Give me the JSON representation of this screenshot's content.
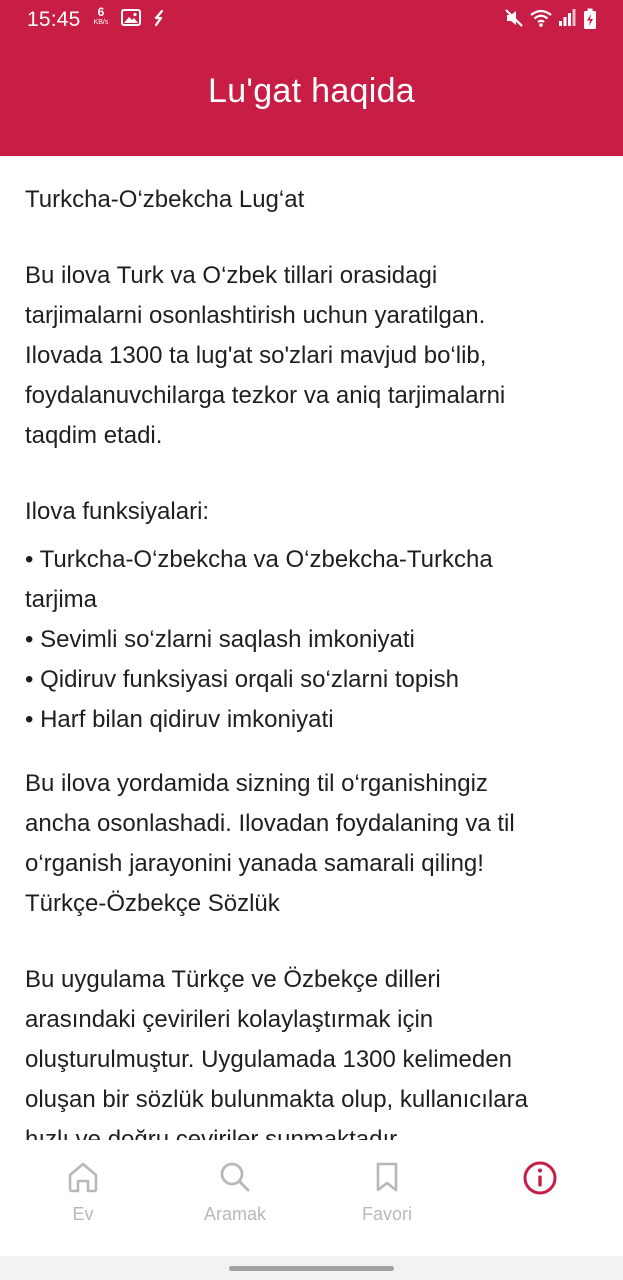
{
  "status_bar": {
    "time": "15:45",
    "net_speed_value": "6",
    "net_speed_unit": "KB/s",
    "icons": [
      "image-icon",
      "sync-icon",
      "mute-icon",
      "wifi-icon",
      "signal-icon",
      "battery-charging-icon"
    ]
  },
  "header": {
    "title": "Lu'gat haqida",
    "background_color": "#c81e45"
  },
  "content": {
    "heading_uz": "Turkcha-O‘zbekcha Lug‘at",
    "intro_uz": "Bu ilova Turk va O‘zbek tillari orasidagi\ntarjimalarni osonlashtirish uchun yaratilgan.\nIlovada 1300 ta lug'at so'zlari mavjud bo‘lib,\nfoydalanuvchilarga tezkor va aniq tarjimalarni\ntaqdim etadi.",
    "features_title": "Ilova funksiyalari:",
    "features": [
      "• Turkcha-O‘zbekcha va O‘zbekcha-Turkcha\ntarjima",
      "• Sevimli so‘zlarni saqlash imkoniyati",
      "• Qidiruv funksiyasi orqali so‘zlarni topish",
      "• Harf bilan qidiruv imkoniyati"
    ],
    "closing_uz": "Bu ilova yordamida sizning til o‘rganishingiz\nancha osonlashadi. Ilovadan foydalaning va til\no‘rganish jarayonini yanada samarali qiling!",
    "heading_tr": "Türkçe-Özbekçe Sözlük",
    "intro_tr": "Bu uygulama Türkçe ve Özbekçe dilleri\narasındaki çevirileri kolaylaştırmak için\noluşturulmuştur. Uygulamada 1300 kelimeden\noluşan bir sözlük bulunmakta olup, kullanıcılara\nhızlı ve doğru çeviriler sunmaktadır."
  },
  "bottom_nav": {
    "items": [
      {
        "label": "Ev",
        "icon": "home-icon",
        "active": false
      },
      {
        "label": "Aramak",
        "icon": "search-icon",
        "active": false
      },
      {
        "label": "Favori",
        "icon": "bookmark-icon",
        "active": false
      },
      {
        "label": "",
        "icon": "info-icon",
        "active": true
      }
    ],
    "active_color": "#c81e45",
    "inactive_color": "#b8b8b8"
  }
}
